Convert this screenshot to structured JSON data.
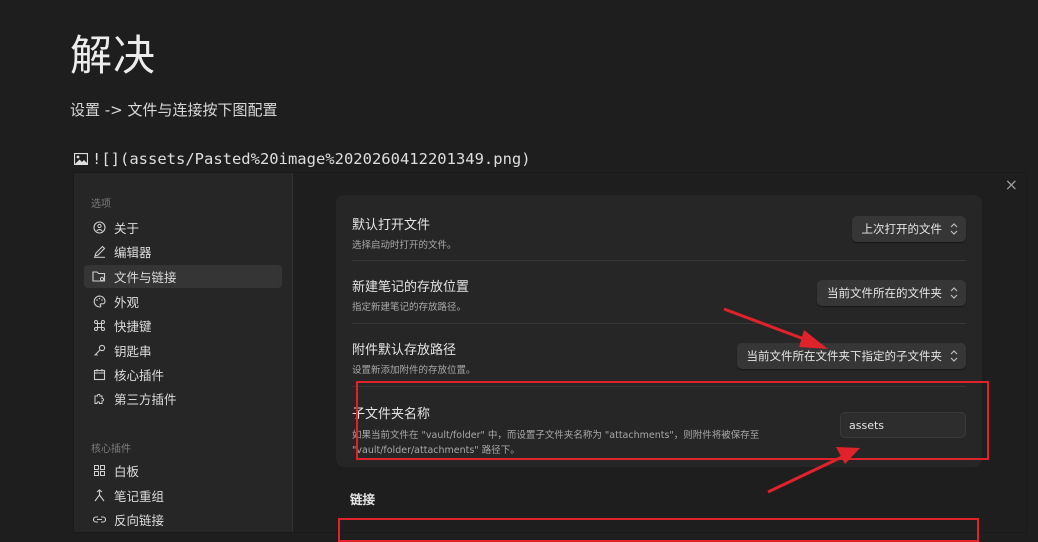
{
  "doc": {
    "heading": "解决",
    "paragraph": "设置 -> 文件与连接按下图配置",
    "embed_text": "![](assets/Pasted%20image%2020260412201349.png)"
  },
  "settings": {
    "close_glyph": "×",
    "sidebar": {
      "section_options": "选项",
      "options_items": [
        {
          "label": "关于",
          "icon": "about-icon"
        },
        {
          "label": "编辑器",
          "icon": "pen-icon"
        },
        {
          "label": "文件与链接",
          "icon": "folder-link-icon",
          "active": true
        },
        {
          "label": "外观",
          "icon": "palette-icon"
        },
        {
          "label": "快捷键",
          "icon": "command-icon"
        },
        {
          "label": "钥匙串",
          "icon": "key-icon"
        },
        {
          "label": "核心插件",
          "icon": "calendar-icon"
        },
        {
          "label": "第三方插件",
          "icon": "puzzle-icon"
        }
      ],
      "section_core": "核心插件",
      "core_items": [
        {
          "label": "白板",
          "icon": "grid-icon"
        },
        {
          "label": "笔记重组",
          "icon": "merge-icon"
        },
        {
          "label": "反向链接",
          "icon": "backlink-icon"
        }
      ]
    },
    "rows": [
      {
        "name": "默认打开文件",
        "desc": "选择启动时打开的文件。",
        "value": "上次打开的文件"
      },
      {
        "name": "新建笔记的存放位置",
        "desc": "指定新建笔记的存放路径。",
        "value": "当前文件所在的文件夹"
      },
      {
        "name": "附件默认存放路径",
        "desc": "设置新添加附件的存放位置。",
        "value": "当前文件所在文件夹下指定的子文件夹"
      },
      {
        "name": "子文件夹名称",
        "desc_line1": "如果当前文件在 \"vault/folder\" 中，而设置子文件夹名称为 \"attachments\"，则附件将被保存至",
        "desc_line2": "\"vault/folder/attachments\" 路径下。",
        "value": "assets"
      }
    ],
    "section_links": "链接"
  },
  "colors": {
    "highlight": "#e0222a",
    "background": "#1e1e1e",
    "panel": "#262626"
  }
}
